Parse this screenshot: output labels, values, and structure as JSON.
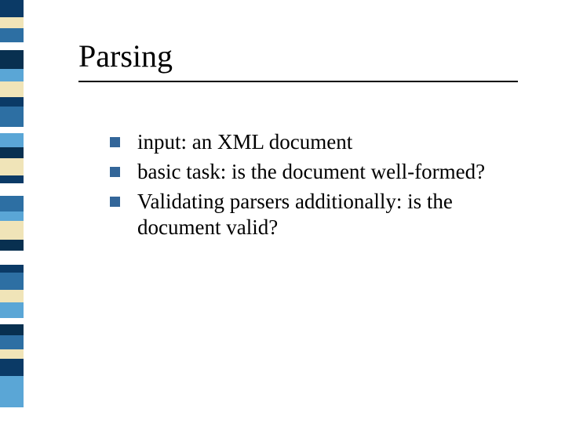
{
  "title": "Parsing",
  "bullets": [
    {
      "text": "input: an XML document"
    },
    {
      "text": "basic task: is the document well-formed?"
    },
    {
      "text": "Validating parsers additionally: is the document valid?"
    }
  ],
  "stripe_colors": [
    "#0b3a66",
    "#f0e4b8",
    "#2d6fa3",
    "#ffffff",
    "#083050",
    "#5aa6d6",
    "#f0e4b8",
    "#0b3a66",
    "#2d6fa3",
    "#ffffff",
    "#5aa6d6",
    "#083050",
    "#f0e4b8",
    "#0b3a66",
    "#ffffff",
    "#2d6fa3",
    "#5aa6d6",
    "#f0e4b8",
    "#083050",
    "#ffffff",
    "#0b3a66",
    "#2d6fa3",
    "#f0e4b8",
    "#5aa6d6",
    "#ffffff",
    "#083050",
    "#2d6fa3",
    "#f0e4b8",
    "#0b3a66",
    "#5aa6d6"
  ],
  "stripe_heights": [
    22,
    14,
    18,
    10,
    24,
    16,
    20,
    12,
    26,
    8,
    18,
    14,
    22,
    10,
    16,
    20,
    12,
    24,
    14,
    18,
    10,
    22,
    16,
    20,
    8,
    14,
    18,
    12,
    22,
    40
  ]
}
